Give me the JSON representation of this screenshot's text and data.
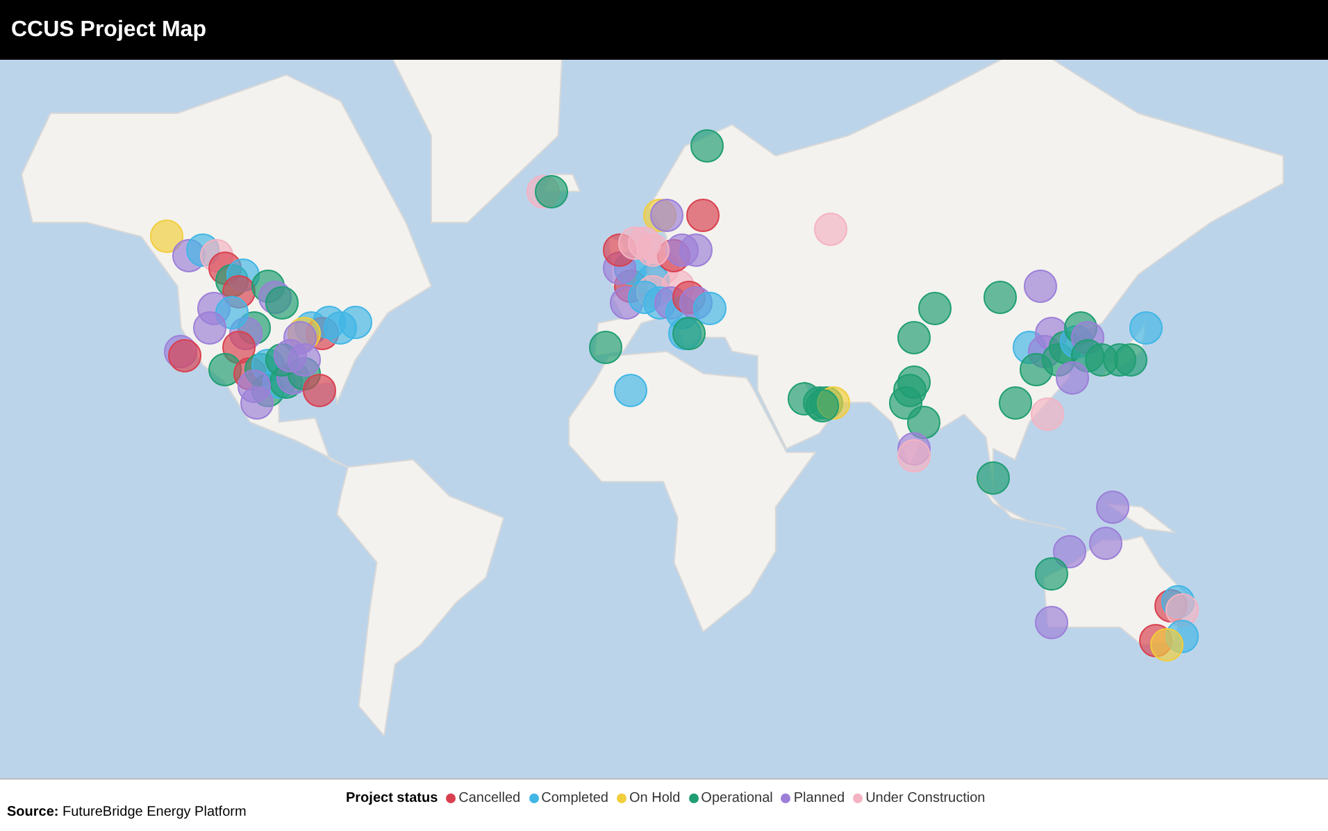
{
  "title": "CCUS Project Map",
  "map": {
    "kind": "picture",
    "markers": [
      {
        "kind": "onhold"
      },
      {
        "kind": "planned"
      },
      {
        "kind": "completed"
      },
      {
        "kind": "construction"
      },
      {
        "kind": "cancelled"
      },
      {
        "kind": "operational"
      },
      {
        "kind": "completed"
      },
      {
        "kind": "cancelled"
      },
      {
        "kind": "operational"
      },
      {
        "kind": "planned"
      },
      {
        "kind": "operational"
      },
      {
        "kind": "completed"
      },
      {
        "kind": "cancelled"
      },
      {
        "kind": "completed"
      },
      {
        "kind": "completed"
      },
      {
        "kind": "completed"
      },
      {
        "kind": "onhold"
      },
      {
        "kind": "planned"
      },
      {
        "kind": "operational"
      },
      {
        "kind": "planned"
      },
      {
        "kind": "cancelled"
      },
      {
        "kind": "planned"
      },
      {
        "kind": "cancelled"
      },
      {
        "kind": "operational"
      },
      {
        "kind": "cancelled"
      },
      {
        "kind": "operational"
      },
      {
        "kind": "completed"
      },
      {
        "kind": "operational"
      },
      {
        "kind": "completed"
      },
      {
        "kind": "operational"
      },
      {
        "kind": "planned"
      },
      {
        "kind": "operational"
      },
      {
        "kind": "operational"
      },
      {
        "kind": "planned"
      },
      {
        "kind": "planned"
      },
      {
        "kind": "planned"
      },
      {
        "kind": "planned"
      },
      {
        "kind": "cancelled"
      },
      {
        "kind": "planned"
      },
      {
        "kind": "completed"
      },
      {
        "kind": "planned"
      },
      {
        "kind": "construction"
      },
      {
        "kind": "operational"
      },
      {
        "kind": "operational"
      },
      {
        "kind": "cancelled"
      },
      {
        "kind": "completed"
      },
      {
        "kind": "planned"
      },
      {
        "kind": "cancelled"
      },
      {
        "kind": "planned"
      },
      {
        "kind": "construction"
      },
      {
        "kind": "completed"
      },
      {
        "kind": "construction"
      },
      {
        "kind": "construction"
      },
      {
        "kind": "cancelled"
      },
      {
        "kind": "planned"
      },
      {
        "kind": "onhold"
      },
      {
        "kind": "planned"
      },
      {
        "kind": "cancelled"
      },
      {
        "kind": "planned"
      },
      {
        "kind": "construction"
      },
      {
        "kind": "construction"
      },
      {
        "kind": "construction"
      },
      {
        "kind": "completed"
      },
      {
        "kind": "completed"
      },
      {
        "kind": "planned"
      },
      {
        "kind": "completed"
      },
      {
        "kind": "cancelled"
      },
      {
        "kind": "planned"
      },
      {
        "kind": "completed"
      },
      {
        "kind": "completed"
      },
      {
        "kind": "operational"
      },
      {
        "kind": "operational"
      },
      {
        "kind": "completed"
      },
      {
        "kind": "construction"
      },
      {
        "kind": "operational"
      },
      {
        "kind": "operational"
      },
      {
        "kind": "operational"
      },
      {
        "kind": "onhold"
      },
      {
        "kind": "operational"
      },
      {
        "kind": "operational"
      },
      {
        "kind": "operational"
      },
      {
        "kind": "operational"
      },
      {
        "kind": "operational"
      },
      {
        "kind": "operational"
      },
      {
        "kind": "operational"
      },
      {
        "kind": "planned"
      },
      {
        "kind": "construction"
      },
      {
        "kind": "operational"
      },
      {
        "kind": "operational"
      },
      {
        "kind": "operational"
      },
      {
        "kind": "planned"
      },
      {
        "kind": "completed"
      },
      {
        "kind": "planned"
      },
      {
        "kind": "planned"
      },
      {
        "kind": "operational"
      },
      {
        "kind": "operational"
      },
      {
        "kind": "completed"
      },
      {
        "kind": "operational"
      },
      {
        "kind": "planned"
      },
      {
        "kind": "operational"
      },
      {
        "kind": "operational"
      },
      {
        "kind": "operational"
      },
      {
        "kind": "operational"
      },
      {
        "kind": "completed"
      },
      {
        "kind": "operational"
      },
      {
        "kind": "construction"
      },
      {
        "kind": "planned"
      },
      {
        "kind": "planned"
      },
      {
        "kind": "planned"
      },
      {
        "kind": "planned"
      },
      {
        "kind": "operational"
      },
      {
        "kind": "planned"
      },
      {
        "kind": "cancelled"
      },
      {
        "kind": "completed"
      },
      {
        "kind": "construction"
      },
      {
        "kind": "cancelled"
      },
      {
        "kind": "completed"
      },
      {
        "kind": "onhold"
      }
    ]
  },
  "legend": {
    "title": "Project status",
    "items": [
      {
        "kind": "cancelled",
        "label": "Cancelled",
        "color": "#d9404f"
      },
      {
        "kind": "completed",
        "label": "Completed",
        "color": "#41b6e6"
      },
      {
        "kind": "onhold",
        "label": "On Hold",
        "color": "#f2cd3c"
      },
      {
        "kind": "operational",
        "label": "Operational",
        "color": "#1f9e72"
      },
      {
        "kind": "planned",
        "label": "Planned",
        "color": "#9c7fd8"
      },
      {
        "kind": "construction",
        "label": "Under Construction",
        "color": "#f4b3c2"
      }
    ]
  },
  "source": "**Source:** FutureBridge Energy Platform"
}
